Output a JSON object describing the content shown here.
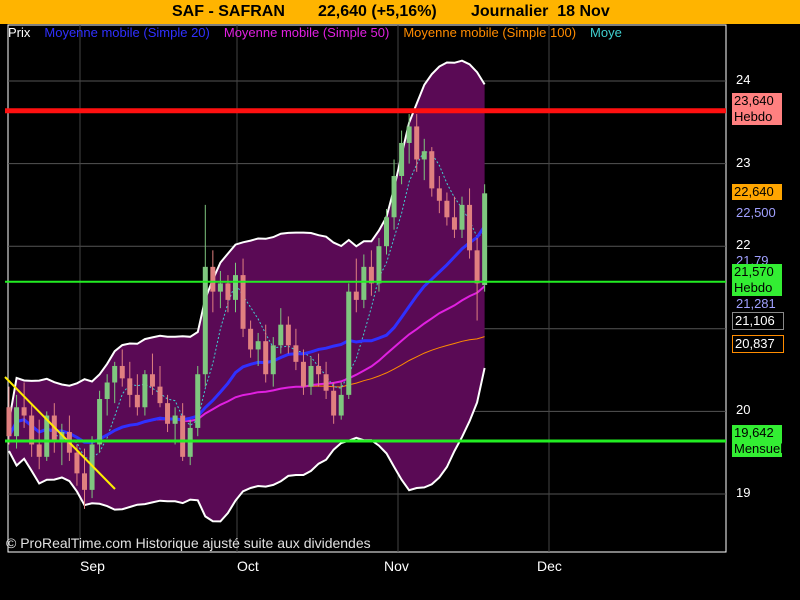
{
  "header": {
    "symbol": "SAF - SAFRAN",
    "price_change": "22,640 (+5,16%)",
    "period": "Journalier  18 Nov"
  },
  "legend": [
    {
      "label": "Prix",
      "color": "#ffffff"
    },
    {
      "label": "Moyenne mobile (Simple 20)",
      "color": "#3030ff"
    },
    {
      "label": "Moyenne mobile (Simple 50)",
      "color": "#e020e0"
    },
    {
      "label": "Moyenne mobile (Simple 100)",
      "color": "#ff8c00"
    },
    {
      "label": "Moye",
      "color": "#40d0d0"
    }
  ],
  "y_labels": [
    "24",
    "23",
    "22",
    "20",
    "19"
  ],
  "x_labels": [
    "Sep",
    "Oct",
    "Nov",
    "Dec"
  ],
  "footer": "© ProRealTime.com Historique ajusté suite aux dividendes",
  "right_boxes": [
    {
      "value": "23,640",
      "sub": "Hebdo",
      "bg": "#ff8080"
    },
    {
      "value": "22,640",
      "sub": "",
      "bg": "#ffa500"
    },
    {
      "value": "21,570",
      "sub": "Hebdo",
      "bg": "#33ee33"
    },
    {
      "value": "21,106",
      "sub": "",
      "bg": "#000000"
    },
    {
      "value": "20,837",
      "sub": "",
      "bg": "#000000"
    },
    {
      "value": "19,642",
      "sub": "Mensuel",
      "bg": "#33ee33"
    }
  ],
  "overlapped_labels": [
    "22,500",
    "21,79",
    "21,281"
  ],
  "colors": {
    "background": "#000000",
    "header": "#ffb400",
    "bollinger_fill": "#5a0a55",
    "bollinger_line": "#ffffff",
    "up_candle": "#7fc77f",
    "down_candle": "#e08080",
    "resistance": "#ff1010",
    "support": "#22ee22",
    "trendline": "#ffee00"
  },
  "chart_data": {
    "type": "candlestick",
    "title": "SAF - SAFRAN",
    "y_range": [
      18.35,
      24.55
    ],
    "y_ticks": [
      19,
      20,
      22,
      23,
      24
    ],
    "x_ticks": [
      "Sep",
      "Oct",
      "Nov",
      "Dec"
    ],
    "last_close": 22.64,
    "change_pct": 5.16,
    "candles": [
      {
        "o": 20.05,
        "h": 20.3,
        "l": 19.6,
        "c": 19.7
      },
      {
        "o": 19.7,
        "h": 20.2,
        "l": 19.55,
        "c": 20.05
      },
      {
        "o": 20.05,
        "h": 20.35,
        "l": 19.8,
        "c": 19.95
      },
      {
        "o": 19.95,
        "h": 20.1,
        "l": 19.45,
        "c": 19.6
      },
      {
        "o": 19.6,
        "h": 19.9,
        "l": 19.3,
        "c": 19.45
      },
      {
        "o": 19.45,
        "h": 20.0,
        "l": 19.4,
        "c": 19.95
      },
      {
        "o": 19.95,
        "h": 20.1,
        "l": 19.5,
        "c": 19.65
      },
      {
        "o": 19.65,
        "h": 19.85,
        "l": 19.35,
        "c": 19.75
      },
      {
        "o": 19.75,
        "h": 19.95,
        "l": 19.4,
        "c": 19.5
      },
      {
        "o": 19.5,
        "h": 19.6,
        "l": 19.1,
        "c": 19.25
      },
      {
        "o": 19.25,
        "h": 19.55,
        "l": 18.82,
        "c": 19.05
      },
      {
        "o": 19.05,
        "h": 19.7,
        "l": 18.95,
        "c": 19.6
      },
      {
        "o": 19.6,
        "h": 20.25,
        "l": 19.5,
        "c": 20.15
      },
      {
        "o": 20.15,
        "h": 20.45,
        "l": 19.95,
        "c": 20.35
      },
      {
        "o": 20.35,
        "h": 20.6,
        "l": 20.1,
        "c": 20.55
      },
      {
        "o": 20.55,
        "h": 20.75,
        "l": 20.3,
        "c": 20.4
      },
      {
        "o": 20.4,
        "h": 20.6,
        "l": 20.05,
        "c": 20.2
      },
      {
        "o": 20.2,
        "h": 20.45,
        "l": 19.95,
        "c": 20.05
      },
      {
        "o": 20.05,
        "h": 20.5,
        "l": 19.95,
        "c": 20.45
      },
      {
        "o": 20.45,
        "h": 20.7,
        "l": 20.2,
        "c": 20.3
      },
      {
        "o": 20.3,
        "h": 20.55,
        "l": 20.05,
        "c": 20.1
      },
      {
        "o": 20.1,
        "h": 20.2,
        "l": 19.75,
        "c": 19.85
      },
      {
        "o": 19.85,
        "h": 20.05,
        "l": 19.6,
        "c": 19.95
      },
      {
        "o": 19.95,
        "h": 20.1,
        "l": 19.4,
        "c": 19.45
      },
      {
        "o": 19.45,
        "h": 19.9,
        "l": 19.35,
        "c": 19.8
      },
      {
        "o": 19.8,
        "h": 20.55,
        "l": 19.7,
        "c": 20.45
      },
      {
        "o": 20.45,
        "h": 22.5,
        "l": 20.3,
        "c": 21.75
      },
      {
        "o": 21.75,
        "h": 21.95,
        "l": 21.2,
        "c": 21.45
      },
      {
        "o": 21.45,
        "h": 21.7,
        "l": 21.25,
        "c": 21.55
      },
      {
        "o": 21.55,
        "h": 21.65,
        "l": 21.2,
        "c": 21.35
      },
      {
        "o": 21.35,
        "h": 21.8,
        "l": 21.2,
        "c": 21.65
      },
      {
        "o": 21.65,
        "h": 21.85,
        "l": 20.9,
        "c": 21.0
      },
      {
        "o": 21.0,
        "h": 21.1,
        "l": 20.65,
        "c": 20.75
      },
      {
        "o": 20.75,
        "h": 20.95,
        "l": 20.55,
        "c": 20.85
      },
      {
        "o": 20.85,
        "h": 21.05,
        "l": 20.35,
        "c": 20.45
      },
      {
        "o": 20.45,
        "h": 20.9,
        "l": 20.3,
        "c": 20.8
      },
      {
        "o": 20.8,
        "h": 21.25,
        "l": 20.7,
        "c": 21.05
      },
      {
        "o": 21.05,
        "h": 21.15,
        "l": 20.7,
        "c": 20.8
      },
      {
        "o": 20.8,
        "h": 21.0,
        "l": 20.5,
        "c": 20.6
      },
      {
        "o": 20.6,
        "h": 20.75,
        "l": 20.2,
        "c": 20.3
      },
      {
        "o": 20.3,
        "h": 20.65,
        "l": 20.2,
        "c": 20.55
      },
      {
        "o": 20.55,
        "h": 20.7,
        "l": 20.3,
        "c": 20.45
      },
      {
        "o": 20.45,
        "h": 20.6,
        "l": 20.15,
        "c": 20.25
      },
      {
        "o": 20.25,
        "h": 20.35,
        "l": 19.85,
        "c": 19.95
      },
      {
        "o": 19.95,
        "h": 20.35,
        "l": 19.9,
        "c": 20.2
      },
      {
        "o": 20.2,
        "h": 21.55,
        "l": 20.15,
        "c": 21.45
      },
      {
        "o": 21.45,
        "h": 21.85,
        "l": 21.2,
        "c": 21.35
      },
      {
        "o": 21.35,
        "h": 21.9,
        "l": 21.25,
        "c": 21.75
      },
      {
        "o": 21.75,
        "h": 21.95,
        "l": 21.4,
        "c": 21.55
      },
      {
        "o": 21.55,
        "h": 22.1,
        "l": 21.45,
        "c": 22.0
      },
      {
        "o": 22.0,
        "h": 22.45,
        "l": 21.9,
        "c": 22.35
      },
      {
        "o": 22.35,
        "h": 23.05,
        "l": 22.2,
        "c": 22.85
      },
      {
        "o": 22.85,
        "h": 23.4,
        "l": 22.75,
        "c": 23.25
      },
      {
        "o": 23.25,
        "h": 23.6,
        "l": 23.0,
        "c": 23.45
      },
      {
        "o": 23.45,
        "h": 23.6,
        "l": 22.9,
        "c": 23.05
      },
      {
        "o": 23.05,
        "h": 23.3,
        "l": 22.8,
        "c": 23.15
      },
      {
        "o": 23.15,
        "h": 23.2,
        "l": 22.6,
        "c": 22.7
      },
      {
        "o": 22.7,
        "h": 22.85,
        "l": 22.4,
        "c": 22.55
      },
      {
        "o": 22.55,
        "h": 22.65,
        "l": 22.25,
        "c": 22.35
      },
      {
        "o": 22.35,
        "h": 22.6,
        "l": 22.1,
        "c": 22.2
      },
      {
        "o": 22.2,
        "h": 22.6,
        "l": 22.1,
        "c": 22.5
      },
      {
        "o": 22.5,
        "h": 22.7,
        "l": 21.85,
        "c": 21.95
      },
      {
        "o": 21.95,
        "h": 22.1,
        "l": 21.1,
        "c": 21.55
      },
      {
        "o": 21.53,
        "h": 22.75,
        "l": 21.45,
        "c": 22.64
      }
    ],
    "series": [
      {
        "name": "Moyenne mobile (Simple 20)",
        "last": 22.5
      },
      {
        "name": "Moyenne mobile (Simple 50)",
        "last": 21.281
      },
      {
        "name": "Moyenne mobile (Simple 100)",
        "last": 20.837
      }
    ],
    "levels": [
      {
        "label": "Hebdo",
        "value": 23.64
      },
      {
        "label": "Hebdo",
        "value": 21.57
      },
      {
        "label": "Mensuel",
        "value": 19.642
      }
    ]
  }
}
